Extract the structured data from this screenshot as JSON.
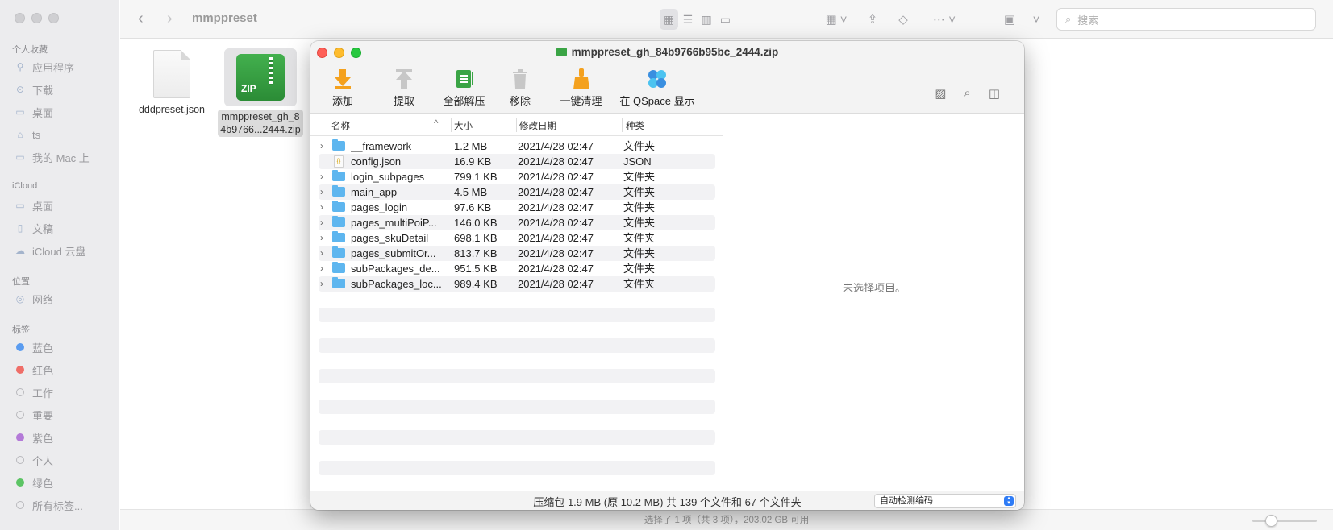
{
  "finder": {
    "title": "mmppreset",
    "search_placeholder": "搜索",
    "sidebar": {
      "favorites_header": "个人收藏",
      "favorites": [
        {
          "label": "应用程序",
          "icon": "apps-icon"
        },
        {
          "label": "下载",
          "icon": "download-icon"
        },
        {
          "label": "桌面",
          "icon": "desktop-icon"
        },
        {
          "label": "ts",
          "icon": "home-icon"
        },
        {
          "label": "我的 Mac 上",
          "icon": "folder-icon"
        }
      ],
      "icloud_header": "iCloud",
      "icloud": [
        {
          "label": "桌面",
          "icon": "desktop-icon"
        },
        {
          "label": "文稿",
          "icon": "document-icon"
        },
        {
          "label": "iCloud 云盘",
          "icon": "cloud-icon"
        }
      ],
      "locations_header": "位置",
      "locations": [
        {
          "label": "网络",
          "icon": "network-icon"
        }
      ],
      "tags_header": "标签",
      "tags": [
        {
          "label": "蓝色",
          "color": "#5a9cf0"
        },
        {
          "label": "红色",
          "color": "#ef6e68"
        },
        {
          "label": "工作",
          "color": ""
        },
        {
          "label": "重要",
          "color": ""
        },
        {
          "label": "紫色",
          "color": "#b47ad8"
        },
        {
          "label": "个人",
          "color": ""
        },
        {
          "label": "绿色",
          "color": "#5cc464"
        },
        {
          "label": "所有标签...",
          "color": ""
        }
      ]
    },
    "files": [
      {
        "name": "dddpreset.json"
      },
      {
        "name_line1": "mmppreset_gh_8",
        "name_line2": "4b9766...2444.zip",
        "zip_label": "ZIP"
      }
    ],
    "status": "选择了 1 项（共 3 项），203.02 GB 可用"
  },
  "archive": {
    "title": "mmppreset_gh_84b9766b95bc_2444.zip",
    "toolbar": [
      {
        "label": "添加",
        "icon": "add-arrow-icon"
      },
      {
        "label": "提取",
        "icon": "extract-arrow-icon"
      },
      {
        "label": "全部解压",
        "icon": "extract-all-icon"
      },
      {
        "label": "移除",
        "icon": "trash-icon"
      },
      {
        "label": "一键清理",
        "icon": "broom-icon"
      },
      {
        "label": "在 QSpace 显示",
        "icon": "qspace-icon"
      }
    ],
    "columns": {
      "name": "名称",
      "size": "大小",
      "date": "修改日期",
      "kind": "种类"
    },
    "rows": [
      {
        "name": "__framework",
        "size": "1.2 MB",
        "date": "2021/4/28 02:47",
        "kind": "文件夹",
        "folder": true
      },
      {
        "name": "config.json",
        "size": "16.9 KB",
        "date": "2021/4/28 02:47",
        "kind": "JSON",
        "folder": false
      },
      {
        "name": "login_subpages",
        "size": "799.1 KB",
        "date": "2021/4/28 02:47",
        "kind": "文件夹",
        "folder": true
      },
      {
        "name": "main_app",
        "size": "4.5 MB",
        "date": "2021/4/28 02:47",
        "kind": "文件夹",
        "folder": true
      },
      {
        "name": "pages_login",
        "size": "97.6 KB",
        "date": "2021/4/28 02:47",
        "kind": "文件夹",
        "folder": true
      },
      {
        "name": "pages_multiPoiP...",
        "size": "146.0 KB",
        "date": "2021/4/28 02:47",
        "kind": "文件夹",
        "folder": true
      },
      {
        "name": "pages_skuDetail",
        "size": "698.1 KB",
        "date": "2021/4/28 02:47",
        "kind": "文件夹",
        "folder": true
      },
      {
        "name": "pages_submitOr...",
        "size": "813.7 KB",
        "date": "2021/4/28 02:47",
        "kind": "文件夹",
        "folder": true
      },
      {
        "name": "subPackages_de...",
        "size": "951.5 KB",
        "date": "2021/4/28 02:47",
        "kind": "文件夹",
        "folder": true
      },
      {
        "name": "subPackages_loc...",
        "size": "989.4 KB",
        "date": "2021/4/28 02:47",
        "kind": "文件夹",
        "folder": true
      }
    ],
    "no_selection": "未选择项目。",
    "summary": "压缩包 1.9 MB (原 10.2 MB) 共 139 个文件和 67 个文件夹",
    "encoding": "自动检测编码"
  }
}
